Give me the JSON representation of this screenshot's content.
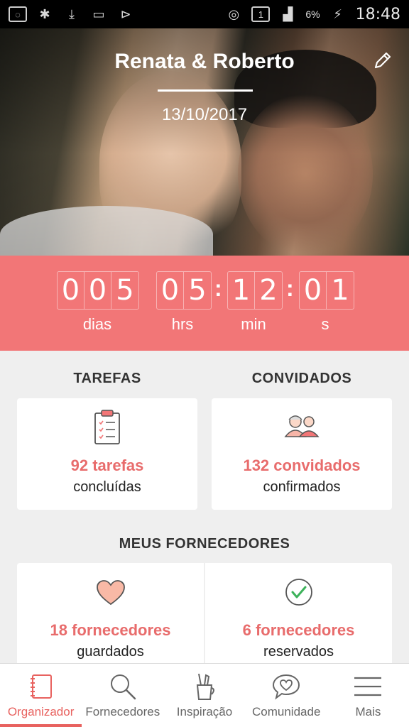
{
  "status_bar": {
    "battery": "6%",
    "time": "18:48",
    "sim": "1"
  },
  "hero": {
    "couple_name": "Renata & Roberto",
    "wedding_date": "13/10/2017"
  },
  "countdown": {
    "days": [
      "0",
      "0",
      "5"
    ],
    "hours": [
      "0",
      "5"
    ],
    "minutes": [
      "1",
      "2"
    ],
    "seconds": [
      "0",
      "1"
    ],
    "labels": {
      "days": "dias",
      "hours": "hrs",
      "minutes": "min",
      "seconds": "s"
    }
  },
  "tasks": {
    "title": "TAREFAS",
    "count": "92 tarefas",
    "sub": "concluídas"
  },
  "guests": {
    "title": "CONVIDADOS",
    "count": "132 convidados",
    "sub": "confirmados"
  },
  "vendors": {
    "title": "MEUS FORNECEDORES",
    "saved_count": "18 fornecedores",
    "saved_sub": "guardados",
    "booked_count": "6 fornecedores",
    "booked_sub": "reservados"
  },
  "nav": [
    {
      "label": "Organizador",
      "icon": "notebook-icon",
      "active": true
    },
    {
      "label": "Fornecedores",
      "icon": "search-icon",
      "active": false
    },
    {
      "label": "Inspiração",
      "icon": "pencil-cup-icon",
      "active": false
    },
    {
      "label": "Comunidade",
      "icon": "chat-heart-icon",
      "active": false
    },
    {
      "label": "Mais",
      "icon": "menu-icon",
      "active": false
    }
  ],
  "colors": {
    "accent": "#f27677",
    "active_nav": "#e8625f"
  }
}
